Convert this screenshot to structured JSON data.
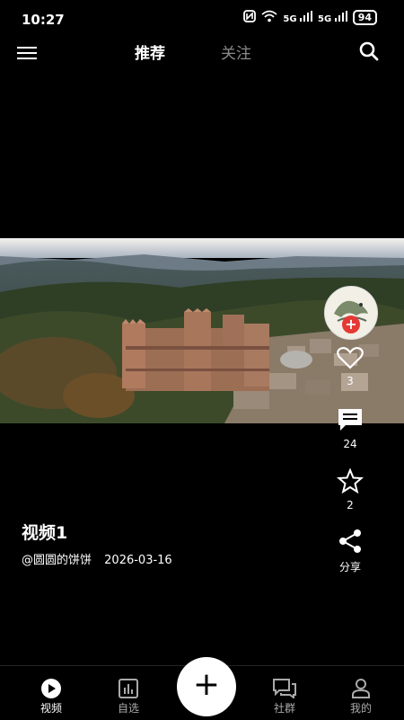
{
  "status": {
    "time": "10:27",
    "battery": "94",
    "network1": "5G",
    "network2": "5G"
  },
  "top_nav": {
    "tabs": [
      {
        "label": "推荐",
        "active": true
      },
      {
        "label": "关注",
        "active": false
      }
    ]
  },
  "video": {
    "title": "视频1",
    "author": "@圆圆的饼饼",
    "date": "2026-03-16"
  },
  "actions": {
    "likes": "3",
    "comments": "24",
    "favorites": "2",
    "share_label": "分享"
  },
  "bottom_nav": {
    "items": [
      {
        "label": "视频",
        "icon": "play-circle-icon",
        "active": true
      },
      {
        "label": "自选",
        "icon": "chart-box-icon",
        "active": false
      },
      {
        "label": "社群",
        "icon": "chat-bubbles-icon",
        "active": false
      },
      {
        "label": "我的",
        "icon": "person-icon",
        "active": false
      }
    ],
    "add_label": "+"
  }
}
